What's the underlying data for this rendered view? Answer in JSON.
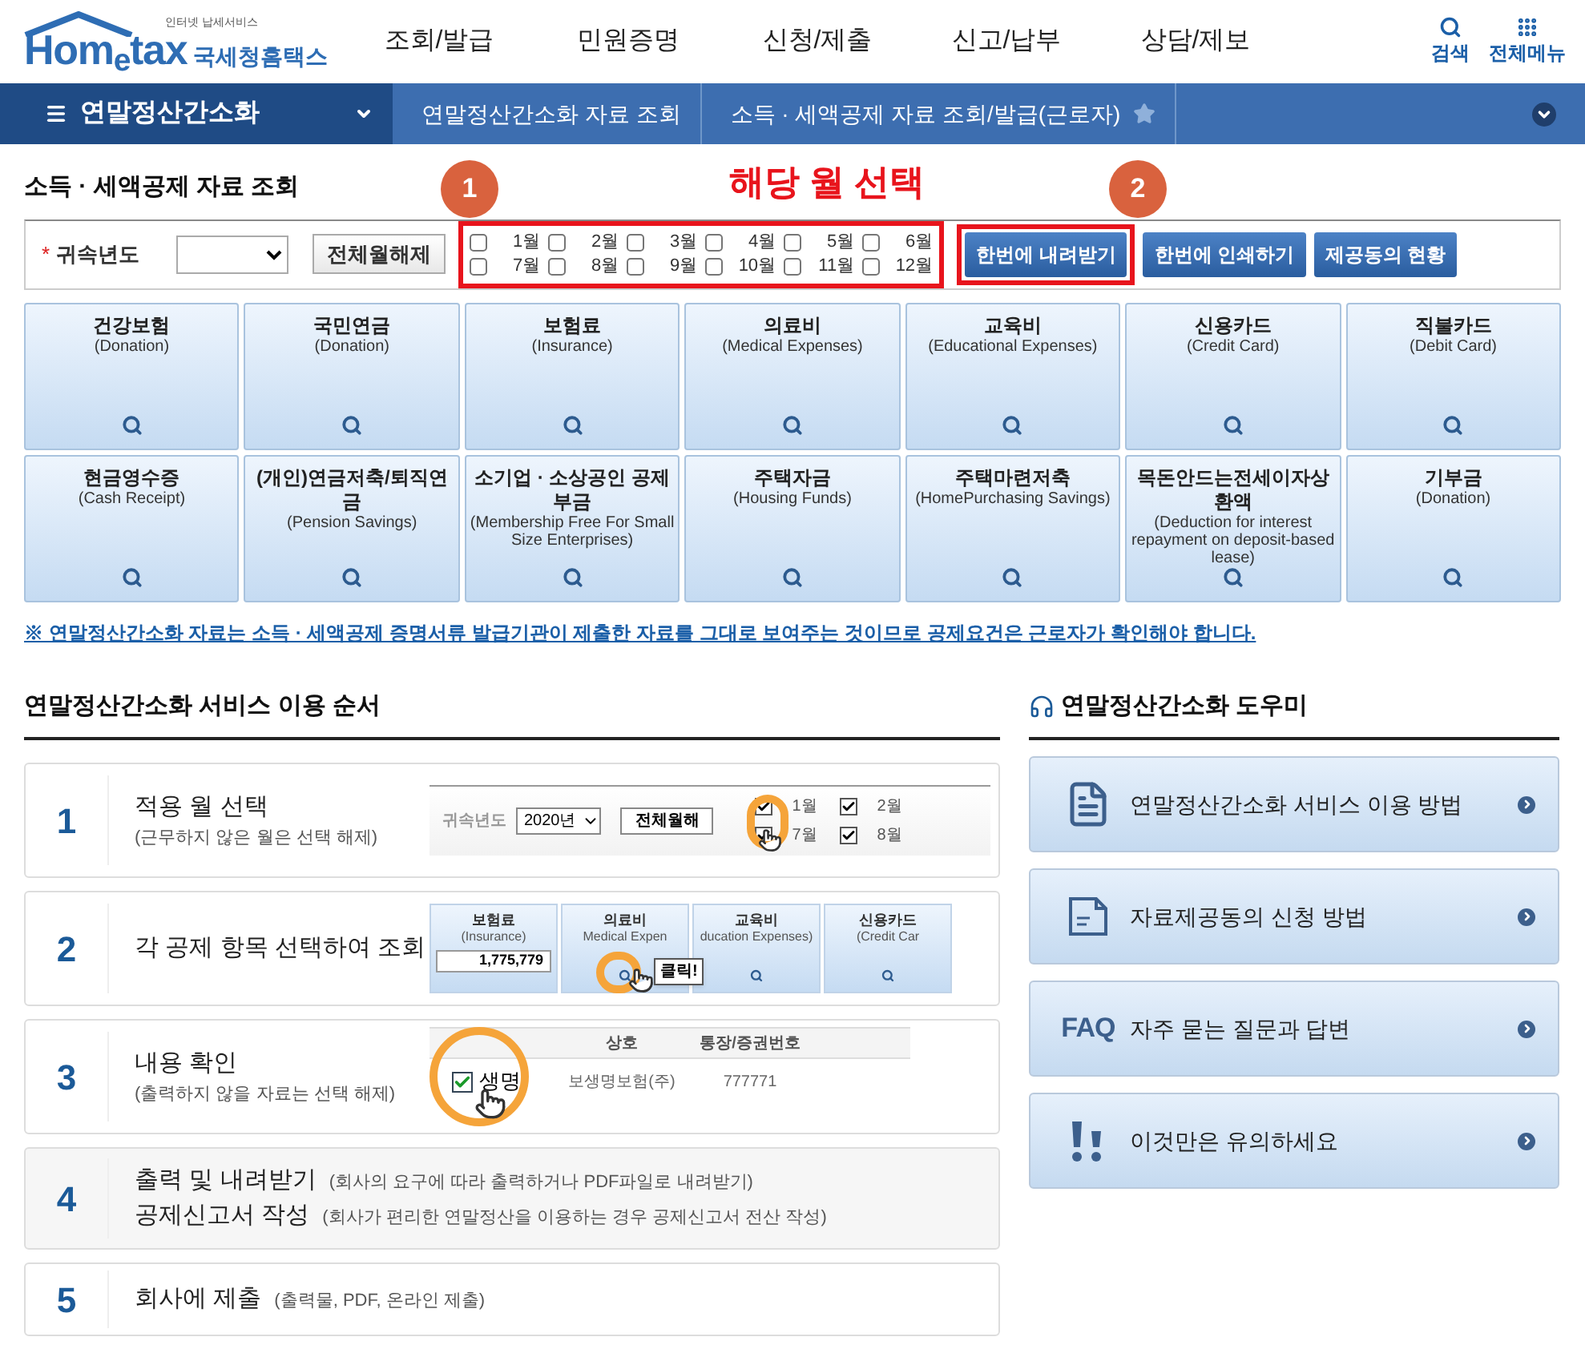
{
  "header": {
    "logo": {
      "tagline": "인터넷 납세서비스",
      "wordmark": "Hom$_{e}$tax",
      "org": "국세청홈택스"
    },
    "menu": [
      "조회/발급",
      "민원증명",
      "신청/제출",
      "신고/납부",
      "상담/제보"
    ],
    "tools": [
      {
        "label": "검색",
        "kind": "search"
      },
      {
        "label": "전체메뉴",
        "kind": "grid"
      }
    ]
  },
  "breadcrumb": {
    "menu": "연말정산간소화",
    "items": [
      {
        "label": "연말정산간소화 자료 조회",
        "favorite": false
      },
      {
        "label": "소득 · 세액공제 자료 조회/발급(근로자)",
        "favorite": true
      }
    ]
  },
  "page_title": "소득 · 세액공제 자료 조회",
  "annotation": {
    "heading": "해당 월 선택",
    "markers": [
      "1",
      "2"
    ]
  },
  "filter": {
    "required_mark": "*",
    "label": "귀속년도",
    "clear_button": "전체월해제",
    "months": [
      {
        "label": "1월",
        "checked": false
      },
      {
        "label": "2월",
        "checked": false
      },
      {
        "label": "3월",
        "checked": false
      },
      {
        "label": "4월",
        "checked": false
      },
      {
        "label": "5월",
        "checked": false
      },
      {
        "label": "6월",
        "checked": false
      },
      {
        "label": "7월",
        "checked": false
      },
      {
        "label": "8월",
        "checked": false
      },
      {
        "label": "9월",
        "checked": false
      },
      {
        "label": "10월",
        "checked": false
      },
      {
        "label": "11월",
        "checked": false
      },
      {
        "label": "12월",
        "checked": false
      }
    ],
    "actions": [
      {
        "label": "한번에 내려받기",
        "highlighted": true
      },
      {
        "label": "한번에 인쇄하기",
        "highlighted": false
      },
      {
        "label": "제공동의 현황",
        "highlighted": false
      }
    ]
  },
  "tiles": [
    {
      "title": "건강보험",
      "subtitle": "(Donation)"
    },
    {
      "title": "국민연금",
      "subtitle": "(Donation)"
    },
    {
      "title": "보험료",
      "subtitle": "(Insurance)"
    },
    {
      "title": "의료비",
      "subtitle": "(Medical Expenses)"
    },
    {
      "title": "교육비",
      "subtitle": "(Educational Expenses)"
    },
    {
      "title": "신용카드",
      "subtitle": "(Credit Card)"
    },
    {
      "title": "직불카드",
      "subtitle": "(Debit Card)"
    },
    {
      "title": "현금영수증",
      "subtitle": "(Cash Receipt)"
    },
    {
      "title": "(개인)연금저축/퇴직연금",
      "subtitle": "(Pension Savings)"
    },
    {
      "title": "소기업 · 소상공인 공제부금",
      "subtitle": "(Membership Free For Small Size Enterprises)"
    },
    {
      "title": "주택자금",
      "subtitle": "(Housing Funds)"
    },
    {
      "title": "주택마련저축",
      "subtitle": "(HomePurchasing Savings)"
    },
    {
      "title": "목돈안드는전세이자상환액",
      "subtitle": "(Deduction for interest repayment on deposit-based lease)"
    },
    {
      "title": "기부금",
      "subtitle": "(Donation)"
    }
  ],
  "notice": "※ 연말정산간소화 자료는 소득 · 세액공제 증명서류 발급기관이 제출한 자료를 그대로 보여주는 것이므로 공제요건은 근로자가 확인해야 합니다.",
  "steps_section": {
    "title": "연말정산간소화 서비스 이용 순서",
    "steps": [
      {
        "number": "1",
        "kind": "illustrated",
        "title": "적용 월 선택",
        "subtitle": "(근무하지 않은 월은 선택 해제)",
        "illustration": {
          "kind": "months",
          "label": "귀속년도",
          "year": "2020년",
          "button": "전체월해",
          "months": [
            {
              "label": "1월",
              "checked": true
            },
            {
              "label": "7월",
              "checked": true
            },
            {
              "label": "2월",
              "checked": true
            },
            {
              "label": "8월",
              "checked": true
            }
          ]
        }
      },
      {
        "number": "2",
        "kind": "illustrated",
        "title": "각 공제 항목 선택하여 조회",
        "illustration": {
          "kind": "tiles",
          "callout": "클릭!",
          "tiles": [
            {
              "title": "보험료",
              "subtitle": "(Insurance)",
              "amount": "1,775,779"
            },
            {
              "title": "의료비",
              "subtitle": "Medical Expen"
            },
            {
              "title": "교육비",
              "subtitle": "ducation Expenses)"
            },
            {
              "title": "신용카드",
              "subtitle": "(Credit Car"
            }
          ]
        }
      },
      {
        "number": "3",
        "kind": "illustrated",
        "title": "내용 확인",
        "subtitle": "(출력하지 않을 자료는 선택 해제)",
        "illustration": {
          "kind": "table",
          "columns": [
            "상호",
            "통장/증권번호"
          ],
          "magnified": "생명",
          "rows": [
            {
              "checked": true,
              "cells": [
                "보생명보험(주)",
                "777771"
              ]
            }
          ]
        }
      },
      {
        "number": "4",
        "kind": "text",
        "lines": [
          {
            "title": "출력 및 내려받기",
            "note": "(회사의 요구에 따라 출력하거나 PDF파일로 내려받기)"
          },
          {
            "title": "공제신고서 작성",
            "note": "(회사가 편리한 연말정산을 이용하는 경우 공제신고서 전산 작성)"
          }
        ]
      },
      {
        "number": "5",
        "kind": "text",
        "lines": [
          {
            "title": "회사에 제출",
            "note": "(출력물, PDF, 온라인 제출)"
          }
        ]
      }
    ]
  },
  "helper": {
    "title": "연말정산간소화 도우미",
    "items": [
      {
        "label": "연말정산간소화 서비스 이용 방법",
        "kind": "guide"
      },
      {
        "label": "자료제공동의 신청 방법",
        "kind": "document"
      },
      {
        "label": "자주 묻는 질문과 답변",
        "kind": "faq",
        "badge": "FAQ"
      },
      {
        "label": "이것만은 유의하세요",
        "kind": "alert"
      }
    ]
  }
}
